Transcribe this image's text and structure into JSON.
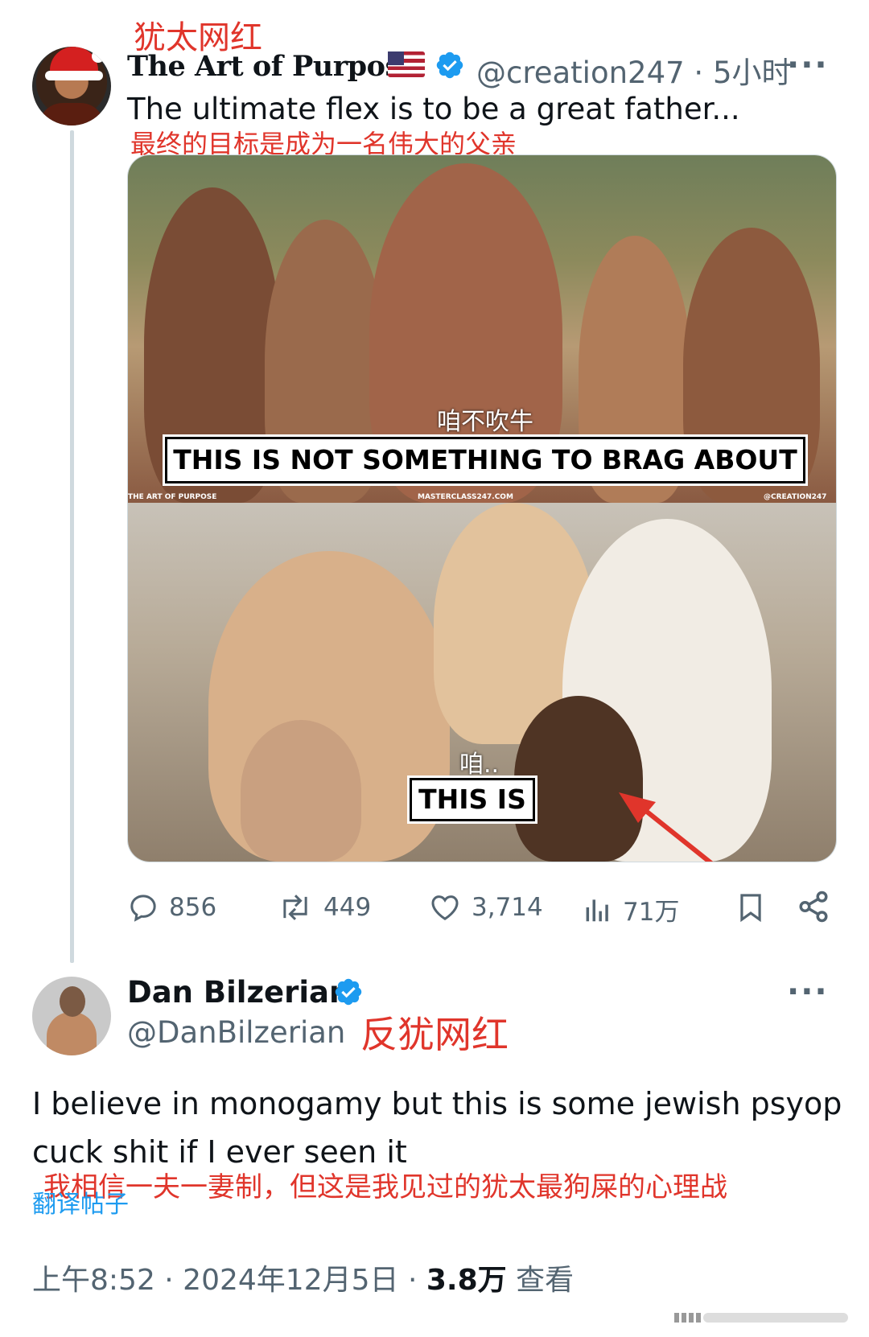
{
  "annotations": {
    "tag_top": "犹太网红",
    "tweet_translation": "最终的目标是成为一名伟大的父亲",
    "tag_reply": "反犹网红",
    "reply_translation": "我相信一夫一妻制，但这是我见过的犹太最狗屎的心理战",
    "sub_top": "咱不吹牛",
    "sub_bottom": "咱.."
  },
  "tweet": {
    "author_name": "The Art of Purpose",
    "flag": "us-flag-emoji",
    "handle_time": "@creation247 · 5小时",
    "text": "The ultimate flex is to be a great father...",
    "media": {
      "caption_top": "THIS IS NOT SOMETHING TO BRAG ABOUT",
      "caption_bottom": "THIS IS",
      "watermark_left": "THE ART OF PURPOSE",
      "watermark_center": "MASTERCLASS247.COM",
      "watermark_right": "@CREATION247"
    },
    "actions": {
      "replies": "856",
      "retweets": "449",
      "likes": "3,714",
      "views": "71万"
    }
  },
  "reply": {
    "author_name": "Dan Bilzerian",
    "handle": "@DanBilzerian",
    "text_line1": "I believe in monogamy but this is some jewish psyop",
    "text_line2": "cuck shit if I ever seen it",
    "translate_link": "翻译帖子",
    "time": "上午8:52 · 2024年12月5日 · ",
    "views_count": "3.8万",
    "views_label": " 查看"
  },
  "colors": {
    "accent": "#1d9bf0",
    "annotation_red": "#e0352b",
    "muted": "#536471"
  }
}
